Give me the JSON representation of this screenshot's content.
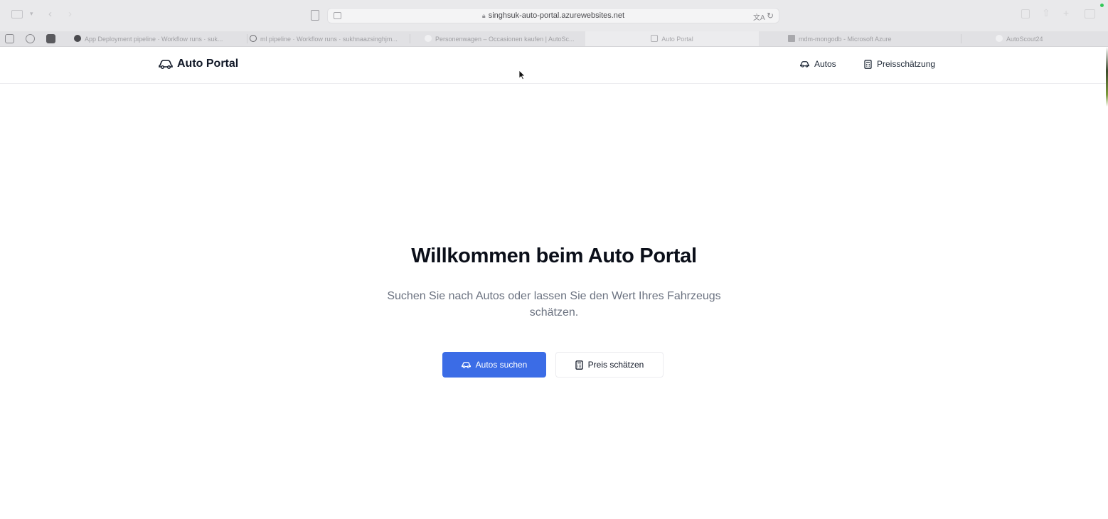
{
  "browser": {
    "url": "singhsuk-auto-portal.azurewebsites.net",
    "tabs": [
      {
        "title": "App Deployment pipeline · Workflow runs · suk..."
      },
      {
        "title": "ml pipeline · Workflow runs · sukhnaazsinghjm..."
      },
      {
        "title": "Personenwagen – Occasionen kaufen | AutoSc..."
      },
      {
        "title": "Auto Portal"
      },
      {
        "title": "mdm-mongodb - Microsoft Azure"
      },
      {
        "title": "AutoScout24"
      }
    ]
  },
  "header": {
    "brand": "Auto Portal",
    "nav": {
      "autos": "Autos",
      "preisschaetzung": "Preisschätzung"
    }
  },
  "hero": {
    "title": "Willkommen beim Auto Portal",
    "subtitle": "Suchen Sie nach Autos oder lassen Sie den Wert Ihres Fahrzeugs schätzen.",
    "primary_button": "Autos suchen",
    "secondary_button": "Preis schätzen"
  },
  "colors": {
    "primary": "#3b6ce6",
    "text": "#111827",
    "muted": "#6b7280"
  }
}
